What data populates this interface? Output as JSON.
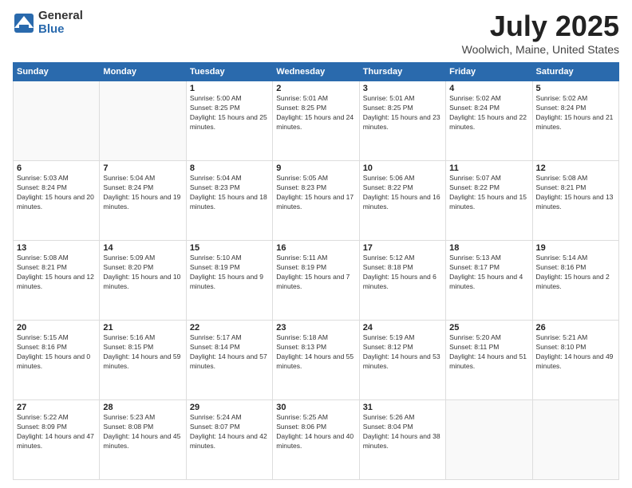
{
  "logo": {
    "general": "General",
    "blue": "Blue"
  },
  "title": "July 2025",
  "subtitle": "Woolwich, Maine, United States",
  "headers": [
    "Sunday",
    "Monday",
    "Tuesday",
    "Wednesday",
    "Thursday",
    "Friday",
    "Saturday"
  ],
  "weeks": [
    [
      {
        "day": "",
        "sunrise": "",
        "sunset": "",
        "daylight": ""
      },
      {
        "day": "",
        "sunrise": "",
        "sunset": "",
        "daylight": ""
      },
      {
        "day": "1",
        "sunrise": "Sunrise: 5:00 AM",
        "sunset": "Sunset: 8:25 PM",
        "daylight": "Daylight: 15 hours and 25 minutes."
      },
      {
        "day": "2",
        "sunrise": "Sunrise: 5:01 AM",
        "sunset": "Sunset: 8:25 PM",
        "daylight": "Daylight: 15 hours and 24 minutes."
      },
      {
        "day": "3",
        "sunrise": "Sunrise: 5:01 AM",
        "sunset": "Sunset: 8:25 PM",
        "daylight": "Daylight: 15 hours and 23 minutes."
      },
      {
        "day": "4",
        "sunrise": "Sunrise: 5:02 AM",
        "sunset": "Sunset: 8:24 PM",
        "daylight": "Daylight: 15 hours and 22 minutes."
      },
      {
        "day": "5",
        "sunrise": "Sunrise: 5:02 AM",
        "sunset": "Sunset: 8:24 PM",
        "daylight": "Daylight: 15 hours and 21 minutes."
      }
    ],
    [
      {
        "day": "6",
        "sunrise": "Sunrise: 5:03 AM",
        "sunset": "Sunset: 8:24 PM",
        "daylight": "Daylight: 15 hours and 20 minutes."
      },
      {
        "day": "7",
        "sunrise": "Sunrise: 5:04 AM",
        "sunset": "Sunset: 8:24 PM",
        "daylight": "Daylight: 15 hours and 19 minutes."
      },
      {
        "day": "8",
        "sunrise": "Sunrise: 5:04 AM",
        "sunset": "Sunset: 8:23 PM",
        "daylight": "Daylight: 15 hours and 18 minutes."
      },
      {
        "day": "9",
        "sunrise": "Sunrise: 5:05 AM",
        "sunset": "Sunset: 8:23 PM",
        "daylight": "Daylight: 15 hours and 17 minutes."
      },
      {
        "day": "10",
        "sunrise": "Sunrise: 5:06 AM",
        "sunset": "Sunset: 8:22 PM",
        "daylight": "Daylight: 15 hours and 16 minutes."
      },
      {
        "day": "11",
        "sunrise": "Sunrise: 5:07 AM",
        "sunset": "Sunset: 8:22 PM",
        "daylight": "Daylight: 15 hours and 15 minutes."
      },
      {
        "day": "12",
        "sunrise": "Sunrise: 5:08 AM",
        "sunset": "Sunset: 8:21 PM",
        "daylight": "Daylight: 15 hours and 13 minutes."
      }
    ],
    [
      {
        "day": "13",
        "sunrise": "Sunrise: 5:08 AM",
        "sunset": "Sunset: 8:21 PM",
        "daylight": "Daylight: 15 hours and 12 minutes."
      },
      {
        "day": "14",
        "sunrise": "Sunrise: 5:09 AM",
        "sunset": "Sunset: 8:20 PM",
        "daylight": "Daylight: 15 hours and 10 minutes."
      },
      {
        "day": "15",
        "sunrise": "Sunrise: 5:10 AM",
        "sunset": "Sunset: 8:19 PM",
        "daylight": "Daylight: 15 hours and 9 minutes."
      },
      {
        "day": "16",
        "sunrise": "Sunrise: 5:11 AM",
        "sunset": "Sunset: 8:19 PM",
        "daylight": "Daylight: 15 hours and 7 minutes."
      },
      {
        "day": "17",
        "sunrise": "Sunrise: 5:12 AM",
        "sunset": "Sunset: 8:18 PM",
        "daylight": "Daylight: 15 hours and 6 minutes."
      },
      {
        "day": "18",
        "sunrise": "Sunrise: 5:13 AM",
        "sunset": "Sunset: 8:17 PM",
        "daylight": "Daylight: 15 hours and 4 minutes."
      },
      {
        "day": "19",
        "sunrise": "Sunrise: 5:14 AM",
        "sunset": "Sunset: 8:16 PM",
        "daylight": "Daylight: 15 hours and 2 minutes."
      }
    ],
    [
      {
        "day": "20",
        "sunrise": "Sunrise: 5:15 AM",
        "sunset": "Sunset: 8:16 PM",
        "daylight": "Daylight: 15 hours and 0 minutes."
      },
      {
        "day": "21",
        "sunrise": "Sunrise: 5:16 AM",
        "sunset": "Sunset: 8:15 PM",
        "daylight": "Daylight: 14 hours and 59 minutes."
      },
      {
        "day": "22",
        "sunrise": "Sunrise: 5:17 AM",
        "sunset": "Sunset: 8:14 PM",
        "daylight": "Daylight: 14 hours and 57 minutes."
      },
      {
        "day": "23",
        "sunrise": "Sunrise: 5:18 AM",
        "sunset": "Sunset: 8:13 PM",
        "daylight": "Daylight: 14 hours and 55 minutes."
      },
      {
        "day": "24",
        "sunrise": "Sunrise: 5:19 AM",
        "sunset": "Sunset: 8:12 PM",
        "daylight": "Daylight: 14 hours and 53 minutes."
      },
      {
        "day": "25",
        "sunrise": "Sunrise: 5:20 AM",
        "sunset": "Sunset: 8:11 PM",
        "daylight": "Daylight: 14 hours and 51 minutes."
      },
      {
        "day": "26",
        "sunrise": "Sunrise: 5:21 AM",
        "sunset": "Sunset: 8:10 PM",
        "daylight": "Daylight: 14 hours and 49 minutes."
      }
    ],
    [
      {
        "day": "27",
        "sunrise": "Sunrise: 5:22 AM",
        "sunset": "Sunset: 8:09 PM",
        "daylight": "Daylight: 14 hours and 47 minutes."
      },
      {
        "day": "28",
        "sunrise": "Sunrise: 5:23 AM",
        "sunset": "Sunset: 8:08 PM",
        "daylight": "Daylight: 14 hours and 45 minutes."
      },
      {
        "day": "29",
        "sunrise": "Sunrise: 5:24 AM",
        "sunset": "Sunset: 8:07 PM",
        "daylight": "Daylight: 14 hours and 42 minutes."
      },
      {
        "day": "30",
        "sunrise": "Sunrise: 5:25 AM",
        "sunset": "Sunset: 8:06 PM",
        "daylight": "Daylight: 14 hours and 40 minutes."
      },
      {
        "day": "31",
        "sunrise": "Sunrise: 5:26 AM",
        "sunset": "Sunset: 8:04 PM",
        "daylight": "Daylight: 14 hours and 38 minutes."
      },
      {
        "day": "",
        "sunrise": "",
        "sunset": "",
        "daylight": ""
      },
      {
        "day": "",
        "sunrise": "",
        "sunset": "",
        "daylight": ""
      }
    ]
  ]
}
